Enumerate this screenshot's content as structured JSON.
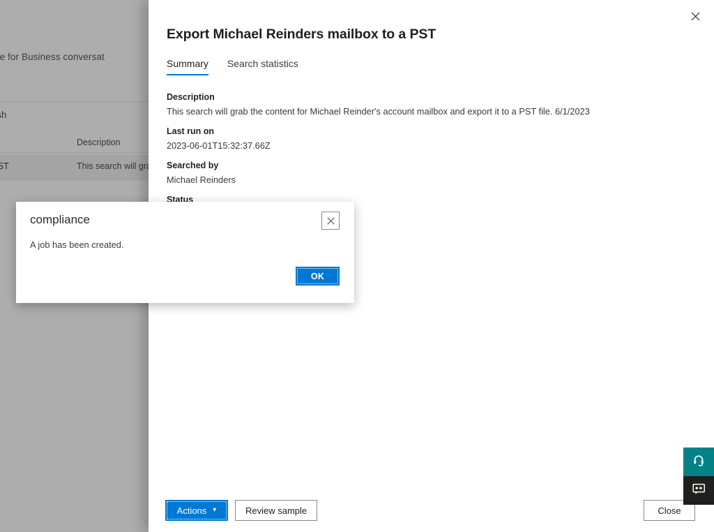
{
  "background": {
    "description_snippet": "s, documents, Skype for Business conversat",
    "refresh_label": "efresh",
    "column_header_description": "Description",
    "row_name": "a PST",
    "row_description": "This search will grab the"
  },
  "flyout": {
    "title": "Export Michael Reinders mailbox to a PST",
    "close_icon": "close-icon",
    "tabs": [
      {
        "label": "Summary",
        "active": true
      },
      {
        "label": "Search statistics",
        "active": false
      }
    ],
    "fields": [
      {
        "label": "Description",
        "value": "This search will grab the content for Michael Reinder's account mailbox and export it to a PST file. 6/1/2023"
      },
      {
        "label": "Last run on",
        "value": "2023-06-01T15:32:37.66Z"
      },
      {
        "label": "Searched by",
        "value": "Michael Reinders"
      },
      {
        "label": "Status",
        "value": ""
      }
    ],
    "footer": {
      "actions_label": "Actions",
      "actions_chevron": "chevron-down-icon",
      "review_sample_label": "Review sample",
      "close_label": "Close"
    }
  },
  "widgets": [
    {
      "name": "help-headset-icon",
      "title": "Help",
      "color": "#038387"
    },
    {
      "name": "feedback-icon",
      "title": "Feedback",
      "color": "#201f1e"
    }
  ],
  "modal": {
    "title": "compliance",
    "message": "A job has been created.",
    "ok_label": "OK",
    "close_icon": "close-icon"
  },
  "colors": {
    "accent": "#0078d4",
    "actions_button": "#0078d4",
    "help_widget": "#038387",
    "feedback_widget": "#201f1e",
    "overlay": "rgba(60,60,60,0.42)"
  }
}
